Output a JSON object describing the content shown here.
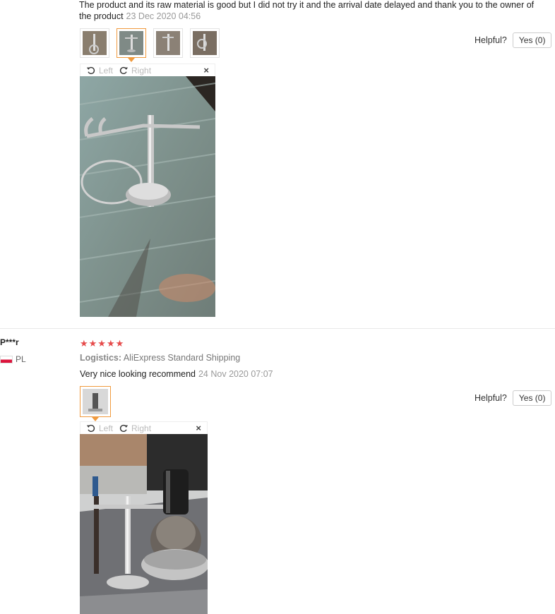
{
  "review1": {
    "text": "The product and its raw material is good but I did not try it and the arrival date delayed and thank you to the owner of the product",
    "date": "23 Dec 2020 04:56",
    "helpful_label": "Helpful?",
    "yes_label": "Yes (0)",
    "viewer": {
      "left_label": "Left",
      "right_label": "Right",
      "close_label": "×"
    },
    "thumb_count": 4,
    "active_thumb": 2
  },
  "review2": {
    "author": "P***r",
    "country": "PL",
    "rating": 5,
    "stars_text": "★★★★★",
    "logistics_label": "Logistics:",
    "logistics_value": "AliExpress Standard Shipping",
    "text": "Very nice looking recommend",
    "date": "24 Nov 2020 07:07",
    "helpful_label": "Helpful?",
    "yes_label": "Yes (0)",
    "viewer": {
      "left_label": "Left",
      "right_label": "Right",
      "close_label": "×"
    },
    "thumb_count": 1,
    "active_thumb": 1
  },
  "colors": {
    "star": "#e64b4b",
    "active_border": "#f09a3e",
    "flag_red": "#dc143c"
  },
  "icons": [
    "rotate-left-icon",
    "rotate-right-icon",
    "close-icon",
    "star-icon",
    "flag-icon"
  ]
}
